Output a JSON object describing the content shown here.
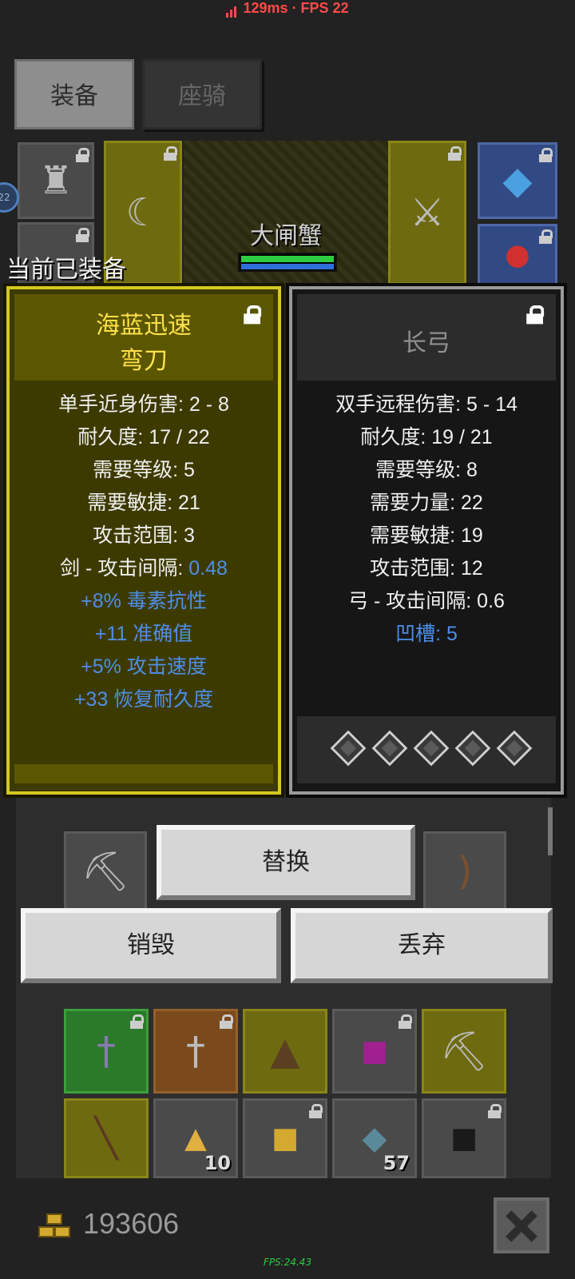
{
  "status": {
    "text": "129ms · FPS 22",
    "color": "#ff4a4a"
  },
  "tabs": [
    {
      "label": "装备",
      "active": true
    },
    {
      "label": "座骑",
      "active": false
    }
  ],
  "boss": {
    "name": "大闸蟹"
  },
  "level_badge": "22",
  "equipped_label": "当前已装备",
  "equipped_item": {
    "name_line1": "海蓝迅速",
    "name_line2": "弯刀",
    "stats": [
      {
        "label": "单手近身伤害: 2 - 8"
      },
      {
        "label": "耐久度: 17 / 22"
      },
      {
        "label": "需要等级: 5"
      },
      {
        "label": "需要敏捷: 21"
      },
      {
        "label": "攻击范围: 3"
      },
      {
        "label": "剑 - 攻击间隔: ",
        "value": "0.48"
      }
    ],
    "affixes": [
      "+8% 毒素抗性",
      "+11 准确值",
      "+5% 攻击速度",
      "+33 恢复耐久度"
    ]
  },
  "compare_item": {
    "name": "长弓",
    "stats": [
      "双手远程伤害: 5 - 14",
      "耐久度: 19 / 21",
      "需要等级: 8",
      "需要力量: 22",
      "需要敏捷: 19",
      "攻击范围: 12",
      "弓 - 攻击间隔: 0.6"
    ],
    "affix": "凹槽: 5",
    "sockets": 5
  },
  "buttons": {
    "replace": "替换",
    "destroy": "销毁",
    "drop": "丢弃"
  },
  "inventory": {
    "counts": {
      "gold_ore": "10",
      "fish": "57"
    }
  },
  "gold": "193606",
  "fps_footer": "FPS:24.43",
  "colors": {
    "yellow_rarity": "#ffe14a",
    "blue_value": "#4e8ee8",
    "fps_green": "#2ecc40"
  }
}
